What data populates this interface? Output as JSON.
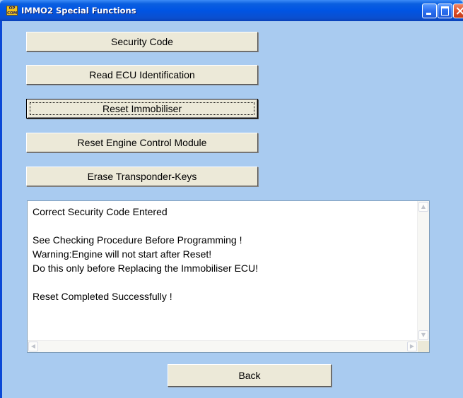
{
  "window": {
    "title": "IMMO2 Special Functions",
    "app_icon_text": "OP COM"
  },
  "buttons": [
    {
      "label": "Security Code"
    },
    {
      "label": "Read ECU Identification"
    },
    {
      "label": "Reset Immobiliser",
      "focused": true
    },
    {
      "label": "Reset Engine Control Module"
    },
    {
      "label": "Erase Transponder-Keys"
    }
  ],
  "output": {
    "lines": [
      "Correct Security Code Entered",
      "",
      "See Checking Procedure Before Programming !",
      "Warning:Engine will not start after Reset!",
      "Do this only before Replacing the Immobiliser ECU!",
      "",
      "Reset Completed Successfully !"
    ]
  },
  "back_button": {
    "label": "Back"
  },
  "colors": {
    "window_bg": "#a9cbf0",
    "title_bar": "#0054e3",
    "button_face": "#ece9d8"
  }
}
